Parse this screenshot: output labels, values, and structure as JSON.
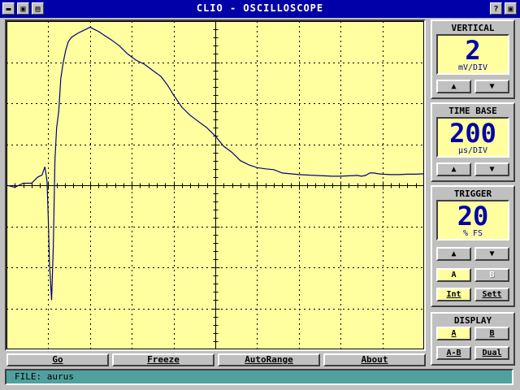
{
  "window": {
    "title": "CLIO - OSCILLOSCOPE",
    "help_label": "?",
    "colors": {
      "titlebar": "#0000a8",
      "screen": "#ffffa0",
      "trace": "#000080",
      "status": "#50a0a0"
    }
  },
  "vertical": {
    "title": "VERTICAL",
    "value": "2",
    "unit": "mV/DIV"
  },
  "timebase": {
    "title": "TIME BASE",
    "value": "200",
    "unit": "µs/DIV"
  },
  "trigger": {
    "title": "TRIGGER",
    "value": "20",
    "unit": "% FS",
    "ch_a": "A",
    "ch_b": "B",
    "int_label": "Int",
    "sett_label": "Sett"
  },
  "display": {
    "title": "DISPLAY",
    "a": "A",
    "b": "B",
    "amb": "A-B",
    "dual": "Dual"
  },
  "buttons": {
    "go": "Go",
    "freeze": "Freeze",
    "autorange": "AutoRange",
    "about": "About"
  },
  "status": {
    "file": "FILE: aurus"
  },
  "icons": {
    "up": "▲",
    "down": "▼"
  },
  "chart_data": {
    "type": "line",
    "grid": true,
    "divisions": {
      "x": 10,
      "y": 8
    },
    "xlim": [
      0,
      10
    ],
    "ylim": [
      -4,
      4
    ],
    "series": [
      {
        "x": [
          0,
          0.2,
          0.4,
          0.6,
          0.75,
          0.85,
          0.92,
          0.97,
          1.0,
          1.03,
          1.08,
          1.12,
          1.16,
          1.2,
          1.25,
          1.3,
          1.36,
          1.42,
          1.48,
          1.55,
          1.62,
          1.7,
          1.8,
          1.9,
          2.0,
          2.1,
          2.2,
          2.35,
          2.5,
          2.7,
          2.9,
          3.1,
          3.3,
          3.5,
          3.7,
          3.85,
          4.0,
          4.2,
          4.4,
          4.6,
          4.8,
          5.0,
          5.2,
          5.4,
          5.6,
          5.8,
          6.0,
          6.2,
          6.4,
          6.6,
          6.8,
          7.0,
          7.2,
          7.4,
          7.6,
          7.8,
          8.0,
          8.2,
          8.4,
          8.5,
          8.6,
          8.7,
          8.8,
          8.9,
          9.0,
          9.2,
          9.4,
          9.6,
          9.8,
          10.0
        ],
        "y": [
          0.0,
          -0.05,
          0.05,
          0.05,
          0.2,
          0.25,
          0.45,
          0.1,
          -0.8,
          -1.9,
          -2.8,
          -1.5,
          0.6,
          1.4,
          1.8,
          2.6,
          3.0,
          3.3,
          3.5,
          3.6,
          3.65,
          3.7,
          3.75,
          3.8,
          3.85,
          3.8,
          3.75,
          3.65,
          3.55,
          3.4,
          3.2,
          3.05,
          2.95,
          2.8,
          2.65,
          2.45,
          2.2,
          1.9,
          1.7,
          1.55,
          1.4,
          1.2,
          0.95,
          0.8,
          0.6,
          0.5,
          0.43,
          0.4,
          0.38,
          0.3,
          0.28,
          0.26,
          0.25,
          0.24,
          0.23,
          0.22,
          0.22,
          0.23,
          0.24,
          0.22,
          0.24,
          0.3,
          0.3,
          0.28,
          0.27,
          0.26,
          0.26,
          0.27,
          0.27,
          0.28
        ]
      }
    ]
  }
}
